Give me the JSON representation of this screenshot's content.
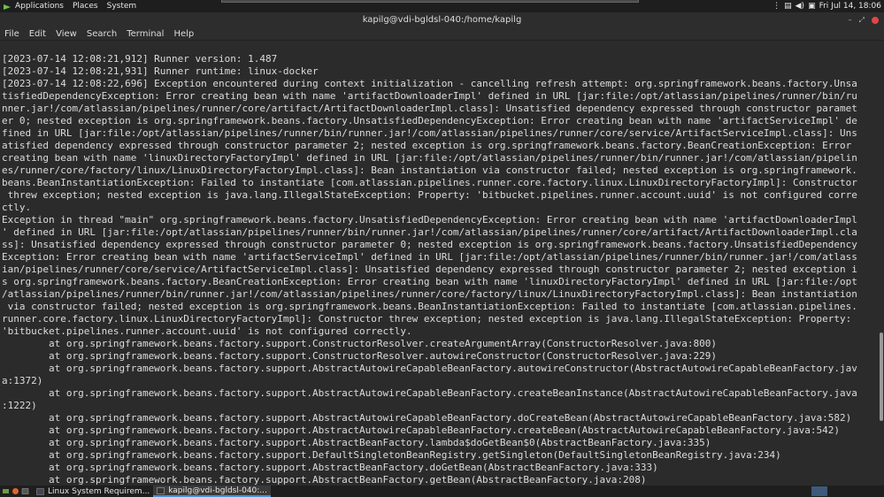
{
  "top_panel": {
    "menus": [
      "Applications",
      "Places",
      "System"
    ],
    "clock": "Fri Jul 14, 18:06"
  },
  "window": {
    "title": "kapilg@vdi-bgldsl-040:/home/kapilg",
    "menu": [
      "File",
      "Edit",
      "View",
      "Search",
      "Terminal",
      "Help"
    ]
  },
  "terminal": {
    "lines": [
      "[2023-07-14 12:08:21,912] Runner version: 1.487",
      "[2023-07-14 12:08:21,931] Runner runtime: linux-docker",
      "[2023-07-14 12:08:22,696] Exception encountered during context initialization - cancelling refresh attempt: org.springframework.beans.factory.Unsa",
      "tisfiedDependencyException: Error creating bean with name 'artifactDownloaderImpl' defined in URL [jar:file:/opt/atlassian/pipelines/runner/bin/ru",
      "nner.jar!/com/atlassian/pipelines/runner/core/artifact/ArtifactDownloaderImpl.class]: Unsatisfied dependency expressed through constructor paramet",
      "er 0; nested exception is org.springframework.beans.factory.UnsatisfiedDependencyException: Error creating bean with name 'artifactServiceImpl' de",
      "fined in URL [jar:file:/opt/atlassian/pipelines/runner/bin/runner.jar!/com/atlassian/pipelines/runner/core/service/ArtifactServiceImpl.class]: Uns",
      "atisfied dependency expressed through constructor parameter 2; nested exception is org.springframework.beans.factory.BeanCreationException: Error",
      "creating bean with name 'linuxDirectoryFactoryImpl' defined in URL [jar:file:/opt/atlassian/pipelines/runner/bin/runner.jar!/com/atlassian/pipelin",
      "es/runner/core/factory/linux/LinuxDirectoryFactoryImpl.class]: Bean instantiation via constructor failed; nested exception is org.springframework.",
      "beans.BeanInstantiationException: Failed to instantiate [com.atlassian.pipelines.runner.core.factory.linux.LinuxDirectoryFactoryImpl]: Constructor",
      " threw exception; nested exception is java.lang.IllegalStateException: Property: 'bitbucket.pipelines.runner.account.uuid' is not configured corre",
      "ctly.",
      "Exception in thread \"main\" org.springframework.beans.factory.UnsatisfiedDependencyException: Error creating bean with name 'artifactDownloaderImpl",
      "' defined in URL [jar:file:/opt/atlassian/pipelines/runner/bin/runner.jar!/com/atlassian/pipelines/runner/core/artifact/ArtifactDownloaderImpl.cla",
      "ss]: Unsatisfied dependency expressed through constructor parameter 0; nested exception is org.springframework.beans.factory.UnsatisfiedDependency",
      "Exception: Error creating bean with name 'artifactServiceImpl' defined in URL [jar:file:/opt/atlassian/pipelines/runner/bin/runner.jar!/com/atlass",
      "ian/pipelines/runner/core/service/ArtifactServiceImpl.class]: Unsatisfied dependency expressed through constructor parameter 2; nested exception i",
      "s org.springframework.beans.factory.BeanCreationException: Error creating bean with name 'linuxDirectoryFactoryImpl' defined in URL [jar:file:/opt",
      "/atlassian/pipelines/runner/bin/runner.jar!/com/atlassian/pipelines/runner/core/factory/linux/LinuxDirectoryFactoryImpl.class]: Bean instantiation",
      " via constructor failed; nested exception is org.springframework.beans.BeanInstantiationException: Failed to instantiate [com.atlassian.pipelines.",
      "runner.core.factory.linux.LinuxDirectoryFactoryImpl]: Constructor threw exception; nested exception is java.lang.IllegalStateException: Property:",
      "'bitbucket.pipelines.runner.account.uuid' is not configured correctly.",
      "        at org.springframework.beans.factory.support.ConstructorResolver.createArgumentArray(ConstructorResolver.java:800)",
      "        at org.springframework.beans.factory.support.ConstructorResolver.autowireConstructor(ConstructorResolver.java:229)",
      "        at org.springframework.beans.factory.support.AbstractAutowireCapableBeanFactory.autowireConstructor(AbstractAutowireCapableBeanFactory.jav",
      "a:1372)",
      "        at org.springframework.beans.factory.support.AbstractAutowireCapableBeanFactory.createBeanInstance(AbstractAutowireCapableBeanFactory.java",
      ":1222)",
      "        at org.springframework.beans.factory.support.AbstractAutowireCapableBeanFactory.doCreateBean(AbstractAutowireCapableBeanFactory.java:582)",
      "        at org.springframework.beans.factory.support.AbstractAutowireCapableBeanFactory.createBean(AbstractAutowireCapableBeanFactory.java:542)",
      "        at org.springframework.beans.factory.support.AbstractBeanFactory.lambda$doGetBean$0(AbstractBeanFactory.java:335)",
      "        at org.springframework.beans.factory.support.DefaultSingletonBeanRegistry.getSingleton(DefaultSingletonBeanRegistry.java:234)",
      "        at org.springframework.beans.factory.support.AbstractBeanFactory.doGetBean(AbstractBeanFactory.java:333)",
      "        at org.springframework.beans.factory.support.AbstractBeanFactory.getBean(AbstractBeanFactory.java:208)"
    ]
  },
  "taskbar": {
    "tasks": [
      {
        "label": "Linux System Requirem...",
        "active": false
      },
      {
        "label": "kapilg@vdi-bgldsl-040:...",
        "active": true
      }
    ]
  }
}
